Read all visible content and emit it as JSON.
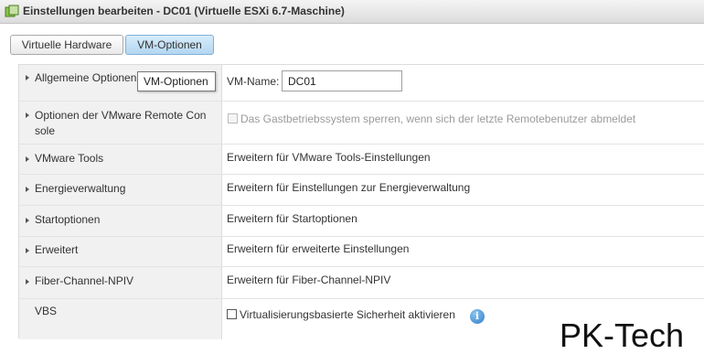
{
  "window": {
    "title": "Einstellungen bearbeiten - DC01 (Virtuelle ESXi 6.7-Maschine)",
    "icon": "vm-icon"
  },
  "tabs": [
    {
      "label": "Virtuelle Hardware",
      "active": false
    },
    {
      "label": "VM-Optionen",
      "active": true
    }
  ],
  "tooltip": "VM-Optionen",
  "rows": [
    {
      "label": "Allgemeine Optionen",
      "vm_name_label": "VM-Name:",
      "vm_name_value": "DC01"
    },
    {
      "label_line1": "Optionen der VMware Remote Con",
      "label_line2": "sole",
      "value": "Das Gastbetriebssystem sperren, wenn sich der letzte Remotebenutzer abmeldet",
      "checked": false,
      "disabled": true
    },
    {
      "label": "VMware Tools",
      "value": "Erweitern für VMware Tools-Einstellungen"
    },
    {
      "label": "Energieverwaltung",
      "value": "Erweitern für Einstellungen zur Energieverwaltung"
    },
    {
      "label": "Startoptionen",
      "value": "Erweitern für Startoptionen"
    },
    {
      "label": "Erweitert",
      "value": "Erweitern für erweiterte Einstellungen"
    },
    {
      "label": "Fiber-Channel-NPIV",
      "value": "Erweitern für Fiber-Channel-NPIV"
    },
    {
      "label": "VBS",
      "value": "Virtualisierungsbasierte Sicherheit aktivieren",
      "checked": false
    }
  ],
  "watermark": "PK-Tech",
  "colors": {
    "active_tab": "#b3d6f1",
    "label_bg": "#f1f1f1",
    "info_icon": "#2f7fc8"
  }
}
